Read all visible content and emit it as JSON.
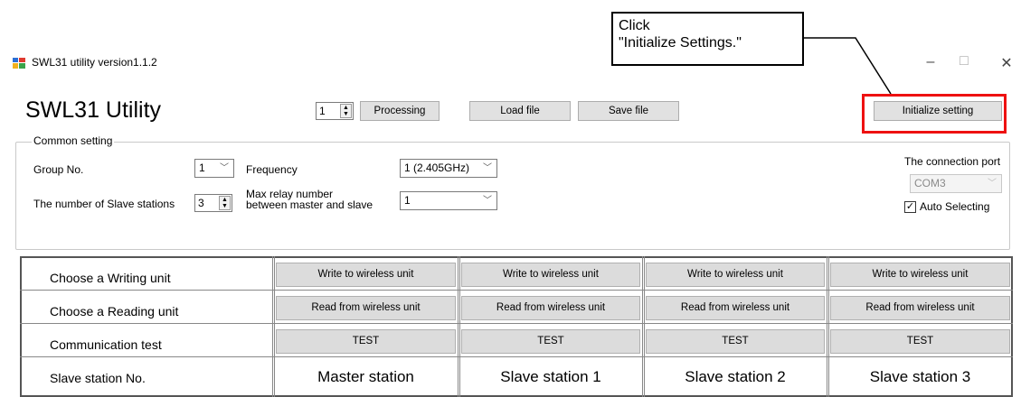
{
  "callout": {
    "line1": "Click",
    "line2": "\"Initialize Settings.\""
  },
  "window": {
    "title": "SWL31 utility version1.1.2",
    "minimize": "–",
    "maximize": "□",
    "close": "✕"
  },
  "header": {
    "app_title": "SWL31 Utility",
    "count_value": "1",
    "processing_label": "Processing",
    "load_file_label": "Load file",
    "save_file_label": "Save file",
    "initialize_label": "Initialize setting"
  },
  "common": {
    "legend": "Common setting",
    "group_label": "Group No.",
    "group_value": "1",
    "slaves_label": "The number of Slave stations",
    "slaves_value": "3",
    "frequency_label": "Frequency",
    "frequency_value": "1 (2.405GHz)",
    "relay_label_line1": "Max relay number",
    "relay_label_line2": "between master and slave",
    "relay_value": "1"
  },
  "port": {
    "label": "The connection port",
    "value": "COM3",
    "auto_label": "Auto Selecting",
    "auto_checked": true
  },
  "grid": {
    "rows": {
      "write": "Choose a Writing unit",
      "read": "Choose a Reading unit",
      "test": "Communication test",
      "station": "Slave station No."
    },
    "write_button": "Write to wireless unit",
    "read_button": "Read from wireless unit",
    "test_button": "TEST",
    "stations": [
      "Master station",
      "Slave station 1",
      "Slave station 2",
      "Slave station 3"
    ]
  },
  "colors": {
    "highlight": "#ee1111",
    "button_face": "#e1e1e1"
  },
  "icons": {
    "app": "app-icon",
    "spin": "spin-arrows-icon",
    "dropdown": "chevron-down-icon",
    "check": "checkmark-icon"
  }
}
